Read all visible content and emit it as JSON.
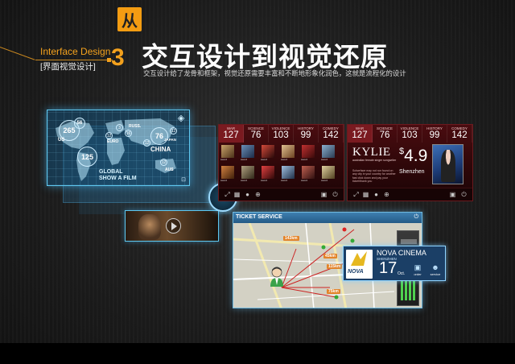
{
  "header": {
    "step_char": "从",
    "step_number": "3",
    "section_en": "Interface Design",
    "section_cn": "[界面视觉设计]",
    "title": "交互设计到视觉还原",
    "subtitle": "交互设计给了龙骨和框架，视觉还原需要丰富和不断地形象化润色，这就是流程化的设计"
  },
  "globe": {
    "bubbles": [
      "265",
      "56",
      "125",
      "76",
      "3",
      "12",
      "16",
      "12",
      "12",
      "12"
    ],
    "regions": [
      "US",
      "EURO",
      "RUSS.",
      "JAPAN",
      "CHINA",
      "AUS"
    ],
    "label_line1": "GLOBAL",
    "label_line2": "SHOW A FILM"
  },
  "categories": {
    "labels": [
      "WAR",
      "SCIENCE",
      "VIOLENCE",
      "HISTORY",
      "COMEDY"
    ],
    "values": [
      "127",
      "76",
      "103",
      "99",
      "142"
    ],
    "thumb_caption": "sword"
  },
  "kylie": {
    "name": "KYLIE",
    "sub": "australian female singer songwriter",
    "desc": "Schwrface may not run found on any city in your country for another fast click down and pay your ticket/thank you",
    "price": "4.9",
    "currency": "$",
    "city": "Shenzhen"
  },
  "ticket": {
    "title": "TICKET SERVICE",
    "distances": [
      "143km",
      "45km",
      "115km",
      "75km"
    ],
    "cinema_name": "NOVA CINEMA",
    "cinema_city": "SHENZHEN",
    "logo_text": "NOVA",
    "day": "17",
    "month": "Oct.",
    "order_label": "order",
    "service_label": "service"
  },
  "colors": {
    "accent": "#f3a11d",
    "panel_red": "#4a0c10",
    "panel_blue": "#1b3f66",
    "glow": "#5ec8f0"
  }
}
